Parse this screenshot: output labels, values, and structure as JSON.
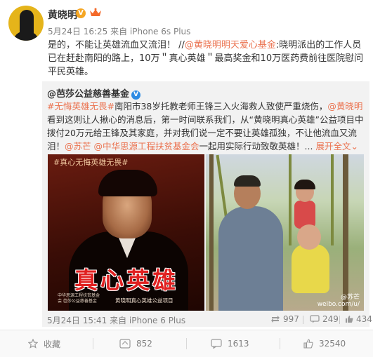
{
  "post": {
    "author": "黄晓明",
    "verified_badge": "V",
    "meta": "5月24日 16:25 来自 iPhone 6s Plus",
    "text_prefix": "是的，不能让英雄流血又流泪！ //",
    "text_mention": "@黄晓明明天爱心基金",
    "text_rest": ":晓明派出的工作人员已在赶赴南阳的路上，10万＂真心英雄＂最高奖金和10万医药费前往医院慰问平民英雄。"
  },
  "repost": {
    "author": "@芭莎公益慈善基金",
    "verified_badge": "V",
    "seg1_link": "#无悔英雄无畏#",
    "seg2": "南阳市38岁托教老师王锋三入火海救人致使严重烧伤，",
    "seg3_link": "@黄晓明",
    "seg4": "看到这则让人揪心的消息后，第一时间联系我们，从“黄晓明真心英雄”公益项目中拨付20万元给王锋及其家庭，并对我们说一定不要让英雄孤独，不让他流血又流泪！",
    "seg5_link": "@苏芒",
    "seg6_link": "@中华思源工程扶贫基金会",
    "seg7": "一起用实际行动致敬英雄！...",
    "expand_label": "展开全文",
    "expand_arrow": "⌄",
    "poster": {
      "tagline": "#真心无悔英雄无畏#",
      "title": "真心英雄",
      "fine_print": "中华思源工程扶贫基金会 芭莎公益慈善基金",
      "subtitle": "黄晓明真心英雄公益项目"
    },
    "photo": {
      "watermark_line1": "@苏芒",
      "watermark_line2": "weibo.com/u/"
    },
    "footer": {
      "time": "5月24日 15:41 来自 iPhone 6 Plus",
      "reposts": "997",
      "comments": "249",
      "likes": "434"
    }
  },
  "actions": {
    "favorite_label": "收藏",
    "repost_count": "852",
    "comment_count": "1613",
    "like_count": "32540"
  },
  "colors": {
    "link": "#eb7350",
    "verified_orange": "#f5a623",
    "verified_blue": "#2d8be3",
    "repost_bg": "#f2f2f2"
  }
}
